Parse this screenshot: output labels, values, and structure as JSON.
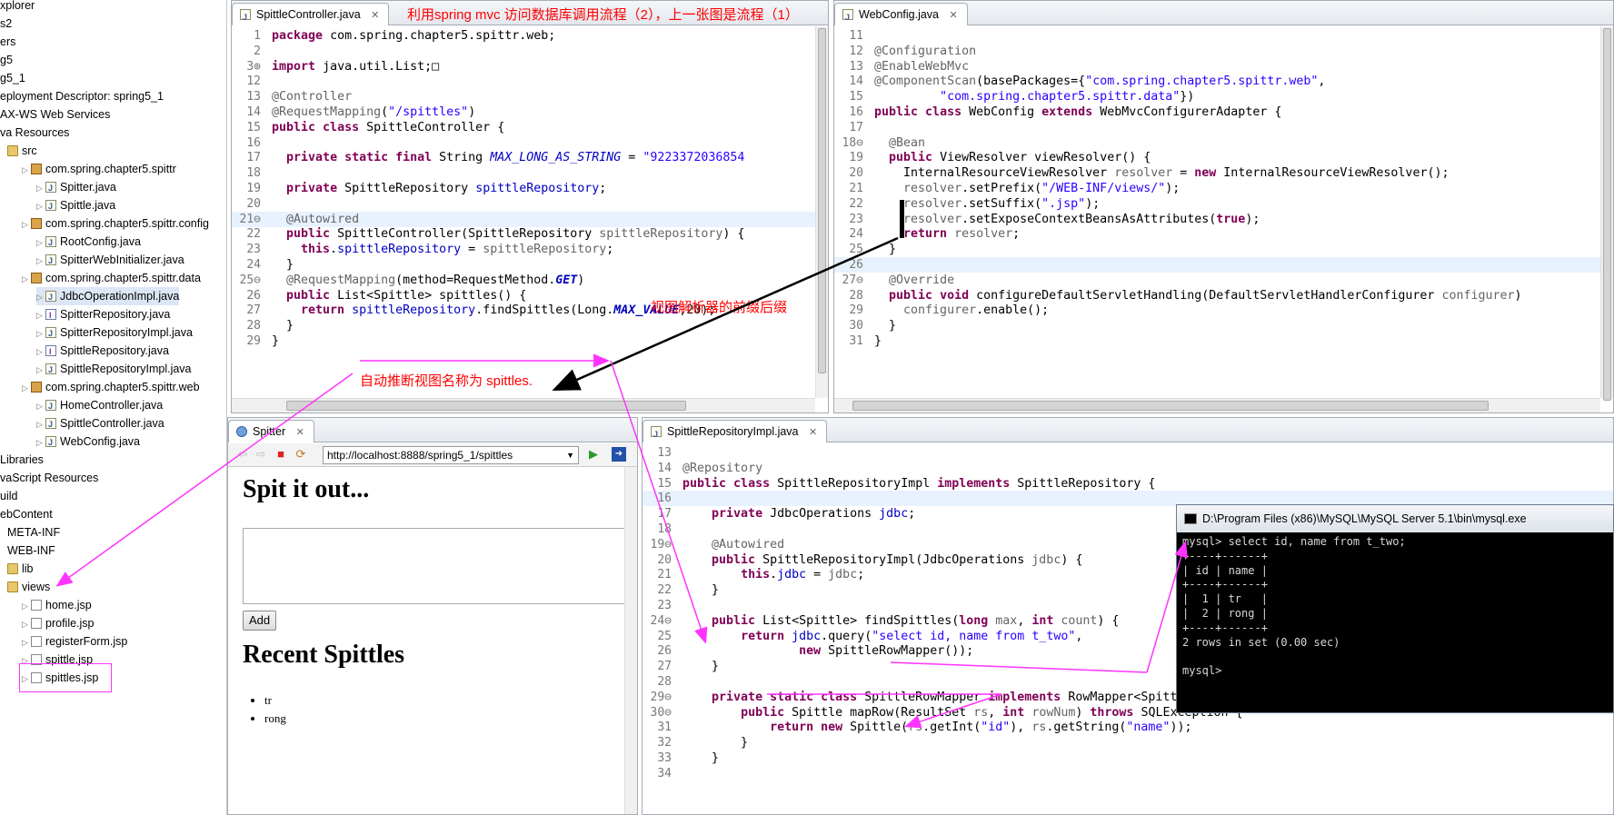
{
  "explorer": {
    "items": [
      {
        "label": "xplorer",
        "indent": 0,
        "icon": "explorer-icon"
      },
      {
        "label": "s2",
        "indent": 0,
        "icon": "none"
      },
      {
        "label": "ers",
        "indent": 0,
        "icon": "none"
      },
      {
        "label": "g5",
        "indent": 0,
        "icon": "none"
      },
      {
        "label": "g5_1",
        "indent": 0,
        "icon": "none"
      },
      {
        "label": "eployment Descriptor: spring5_1",
        "indent": 0,
        "icon": "none"
      },
      {
        "label": "AX-WS Web Services",
        "indent": 0,
        "icon": "none"
      },
      {
        "label": "va Resources",
        "indent": 0,
        "icon": "none"
      },
      {
        "label": "src",
        "indent": 1,
        "icon": "folder"
      },
      {
        "label": "com.spring.chapter5.spittr",
        "indent": 2,
        "icon": "pkg"
      },
      {
        "label": "Spitter.java",
        "indent": 3,
        "icon": "java"
      },
      {
        "label": "Spittle.java",
        "indent": 3,
        "icon": "java"
      },
      {
        "label": "com.spring.chapter5.spittr.config",
        "indent": 2,
        "icon": "pkg"
      },
      {
        "label": "RootConfig.java",
        "indent": 3,
        "icon": "java"
      },
      {
        "label": "SpitterWebInitializer.java",
        "indent": 3,
        "icon": "java"
      },
      {
        "label": "com.spring.chapter5.spittr.data",
        "indent": 2,
        "icon": "pkg"
      },
      {
        "label": "JdbcOperationImpl.java",
        "indent": 3,
        "icon": "java",
        "selected": true
      },
      {
        "label": "SpitterRepository.java",
        "indent": 3,
        "icon": "iface"
      },
      {
        "label": "SpitterRepositoryImpl.java",
        "indent": 3,
        "icon": "java"
      },
      {
        "label": "SpittleRepository.java",
        "indent": 3,
        "icon": "iface"
      },
      {
        "label": "SpittleRepositoryImpl.java",
        "indent": 3,
        "icon": "java"
      },
      {
        "label": "com.spring.chapter5.spittr.web",
        "indent": 2,
        "icon": "pkg"
      },
      {
        "label": "HomeController.java",
        "indent": 3,
        "icon": "java"
      },
      {
        "label": "SpittleController.java",
        "indent": 3,
        "icon": "java"
      },
      {
        "label": "WebConfig.java",
        "indent": 3,
        "icon": "java"
      },
      {
        "label": "Libraries",
        "indent": 0,
        "icon": "none"
      },
      {
        "label": "vaScript Resources",
        "indent": 0,
        "icon": "none"
      },
      {
        "label": "uild",
        "indent": 0,
        "icon": "none"
      },
      {
        "label": "ebContent",
        "indent": 0,
        "icon": "none"
      },
      {
        "label": "META-INF",
        "indent": 1,
        "icon": "none"
      },
      {
        "label": "WEB-INF",
        "indent": 1,
        "icon": "none"
      },
      {
        "label": "lib",
        "indent": 1,
        "icon": "folder"
      },
      {
        "label": "views",
        "indent": 1,
        "icon": "folder"
      },
      {
        "label": "home.jsp",
        "indent": 2,
        "icon": "jsp"
      },
      {
        "label": "profile.jsp",
        "indent": 2,
        "icon": "jsp"
      },
      {
        "label": "registerForm.jsp",
        "indent": 2,
        "icon": "jsp"
      },
      {
        "label": "spittle.jsp",
        "indent": 2,
        "icon": "jsp"
      },
      {
        "label": "spittles.jsp",
        "indent": 2,
        "icon": "jsp"
      }
    ]
  },
  "notes": {
    "top_title": "利用spring mvc 访问数据库调用流程（2），上一张图是流程（1）",
    "view_resolver": "视图解析器的前缀后缀",
    "auto_view": "自动推断视图名称为 spittles."
  },
  "controller_editor": {
    "tab": "SpittleController.java",
    "lines": [
      {
        "n": "1",
        "t": "<span class='kw'>package</span> com.spring.chapter5.spittr.web;"
      },
      {
        "n": "2",
        "t": ""
      },
      {
        "n": "3⊕",
        "t": "<span class='kw'>import</span> java.util.List;□"
      },
      {
        "n": "12",
        "t": ""
      },
      {
        "n": "13",
        "t": "<span class='an'>@Controller</span>"
      },
      {
        "n": "14",
        "t": "<span class='an'>@RequestMapping</span>(<span class='st'>\"/spittles\"</span>)"
      },
      {
        "n": "15",
        "t": "<span class='kw'>public class</span> SpittleController {"
      },
      {
        "n": "16",
        "t": ""
      },
      {
        "n": "17",
        "t": "  <span class='kw'>private static final</span> String <span class='fd it'>MAX_LONG_AS_STRING</span> = <span class='st'>\"9223372036854</span>"
      },
      {
        "n": "18",
        "t": ""
      },
      {
        "n": "19",
        "t": "  <span class='kw'>private</span> SpittleRepository <span class='fd'>spittleRepository</span>;"
      },
      {
        "n": "20",
        "t": ""
      },
      {
        "n": "21⊖",
        "t": "  <span class='an'>@Autowired</span>",
        "hl": true
      },
      {
        "n": "22",
        "t": "  <span class='kw'>public</span> SpittleController(SpittleRepository <span class='an'>spittleRepository</span>) {"
      },
      {
        "n": "23",
        "t": "    <span class='kw'>this</span>.<span class='fd'>spittleRepository</span> = <span class='an'>spittleRepository</span>;"
      },
      {
        "n": "24",
        "t": "  }"
      },
      {
        "n": "25⊖",
        "t": "  <span class='an'>@RequestMapping</span>(method=RequestMethod.<span class='fd it'><b>GET</b></span>)"
      },
      {
        "n": "26",
        "t": "  <span class='kw'>public</span> List&lt;Spittle&gt; spittles() {"
      },
      {
        "n": "27",
        "t": "    <span class='kw'>return</span> <span class='fd'>spittleRepository</span>.findSpittles(Long.<span class='fd it'><b>MAX_VALUE</b></span>,20);"
      },
      {
        "n": "28",
        "t": "  }"
      },
      {
        "n": "29",
        "t": "}"
      }
    ]
  },
  "webconfig_editor": {
    "tab": "WebConfig.java",
    "lines": [
      {
        "n": "11",
        "t": ""
      },
      {
        "n": "12",
        "t": "<span class='an'>@Configuration</span>"
      },
      {
        "n": "13",
        "t": "<span class='an'>@EnableWebMvc</span>"
      },
      {
        "n": "14",
        "t": "<span class='an'>@ComponentScan</span>(basePackages={<span class='st'>\"com.spring.chapter5.spittr.web\"</span>,"
      },
      {
        "n": "15",
        "t": "         <span class='st'>\"com.spring.chapter5.spittr.data\"</span>})"
      },
      {
        "n": "16",
        "t": "<span class='kw'>public class</span> WebConfig <span class='kw'>extends</span> WebMvcConfigurerAdapter {"
      },
      {
        "n": "17",
        "t": ""
      },
      {
        "n": "18⊖",
        "t": "  <span class='an'>@Bean</span>"
      },
      {
        "n": "19",
        "t": "  <span class='kw'>public</span> ViewResolver viewResolver() {"
      },
      {
        "n": "20",
        "t": "    InternalResourceViewResolver <span class='an'>resolver</span> = <span class='kw'>new</span> InternalResourceViewResolver();"
      },
      {
        "n": "21",
        "t": "    <span class='an'>resolver</span>.setPrefix(<span class='st'>\"/WEB-INF/views/\"</span>);"
      },
      {
        "n": "22",
        "t": "    <span class='an'>resolver</span>.setSuffix(<span class='st'>\".jsp\"</span>);"
      },
      {
        "n": "23",
        "t": "    <span class='an'>resolver</span>.setExposeContextBeansAsAttributes(<span class='kw'>true</span>);"
      },
      {
        "n": "24",
        "t": "    <span class='kw'>return</span> <span class='an'>resolver</span>;"
      },
      {
        "n": "25",
        "t": "  }"
      },
      {
        "n": "26",
        "t": "",
        "hl": true
      },
      {
        "n": "27⊖",
        "t": "  <span class='an'>@Override</span>"
      },
      {
        "n": "28",
        "t": "  <span class='kw'>public void</span> configureDefaultServletHandling(DefaultServletHandlerConfigurer <span class='an'>configurer</span>)"
      },
      {
        "n": "29",
        "t": "    <span class='an'>configurer</span>.enable();"
      },
      {
        "n": "30",
        "t": "  }"
      },
      {
        "n": "31",
        "t": "}"
      }
    ]
  },
  "repo_editor": {
    "tab": "SpittleRepositoryImpl.java",
    "lines": [
      {
        "n": "13",
        "t": ""
      },
      {
        "n": "14",
        "t": "<span class='an'>@Repository</span>"
      },
      {
        "n": "15",
        "t": "<span class='kw'>public class</span> SpittleRepositoryImpl <span class='kw'>implements</span> SpittleRepository {"
      },
      {
        "n": "16",
        "t": "",
        "hl": true
      },
      {
        "n": "17",
        "t": "    <span class='kw'>private</span> JdbcOperations <span class='fd'>jdbc</span>;"
      },
      {
        "n": "18",
        "t": ""
      },
      {
        "n": "19⊖",
        "t": "    <span class='an'>@Autowired</span>"
      },
      {
        "n": "20",
        "t": "    <span class='kw'>public</span> SpittleRepositoryImpl(JdbcOperations <span class='an'>jdbc</span>) {"
      },
      {
        "n": "21",
        "t": "        <span class='kw'>this</span>.<span class='fd'>jdbc</span> = <span class='an'>jdbc</span>;"
      },
      {
        "n": "22",
        "t": "    }"
      },
      {
        "n": "23",
        "t": ""
      },
      {
        "n": "24⊖",
        "t": "    <span class='kw'>public</span> List&lt;Spittle&gt; findSpittles(<span class='kw'>long</span> <span class='an'>max</span>, <span class='kw'>int</span> <span class='an'>count</span>) {"
      },
      {
        "n": "25",
        "t": "        <span class='kw'>return</span> <span class='fd'>jdbc</span>.query(<span class='st'>\"select id, name from t_two\"</span>,"
      },
      {
        "n": "26",
        "t": "                <span class='kw'>new</span> SpittleRowMapper());"
      },
      {
        "n": "27",
        "t": "    }"
      },
      {
        "n": "28",
        "t": ""
      },
      {
        "n": "29⊖",
        "t": "    <span class='kw'>private static class</span> SpittleRowMapper <span class='kw'>implements</span> RowMapper&lt;Spittle&gt; {"
      },
      {
        "n": "30⊖",
        "t": "        <span class='kw'>public</span> Spittle mapRow(ResultSet <span class='an'>rs</span>, <span class='kw'>int</span> <span class='an'>rowNum</span>) <span class='kw'>throws</span> SQLException {"
      },
      {
        "n": "31",
        "t": "            <span class='kw'>return new</span> Spittle(<span class='an'>rs</span>.getInt(<span class='st'>\"id\"</span>), <span class='an'>rs</span>.getString(<span class='st'>\"name\"</span>));"
      },
      {
        "n": "32",
        "t": "        }"
      },
      {
        "n": "33",
        "t": "    }"
      },
      {
        "n": "34",
        "t": ""
      }
    ]
  },
  "browser": {
    "tab": "Spitter",
    "url": "http://localhost:8888/spring5_1/spittles",
    "heading": "Spit it out...",
    "add_button": "Add",
    "recent_heading": "Recent Spittles",
    "items": [
      "tr",
      "rong"
    ]
  },
  "console": {
    "title": "D:\\Program Files (x86)\\MySQL\\MySQL Server 5.1\\bin\\mysql.exe",
    "lines": [
      "mysql> select id, name from t_two;",
      "+----+------+",
      "| id | name |",
      "+----+------+",
      "|  1 | tr   |",
      "|  2 | rong |",
      "+----+------+",
      "2 rows in set (0.00 sec)",
      "",
      "mysql>"
    ]
  },
  "colors": {
    "annotation_red": "#ff0000",
    "arrow_magenta": "#ff33ff",
    "keyword": "#7f0055",
    "annotation": "#646464",
    "string": "#2a00ff",
    "field": "#0000c0"
  }
}
